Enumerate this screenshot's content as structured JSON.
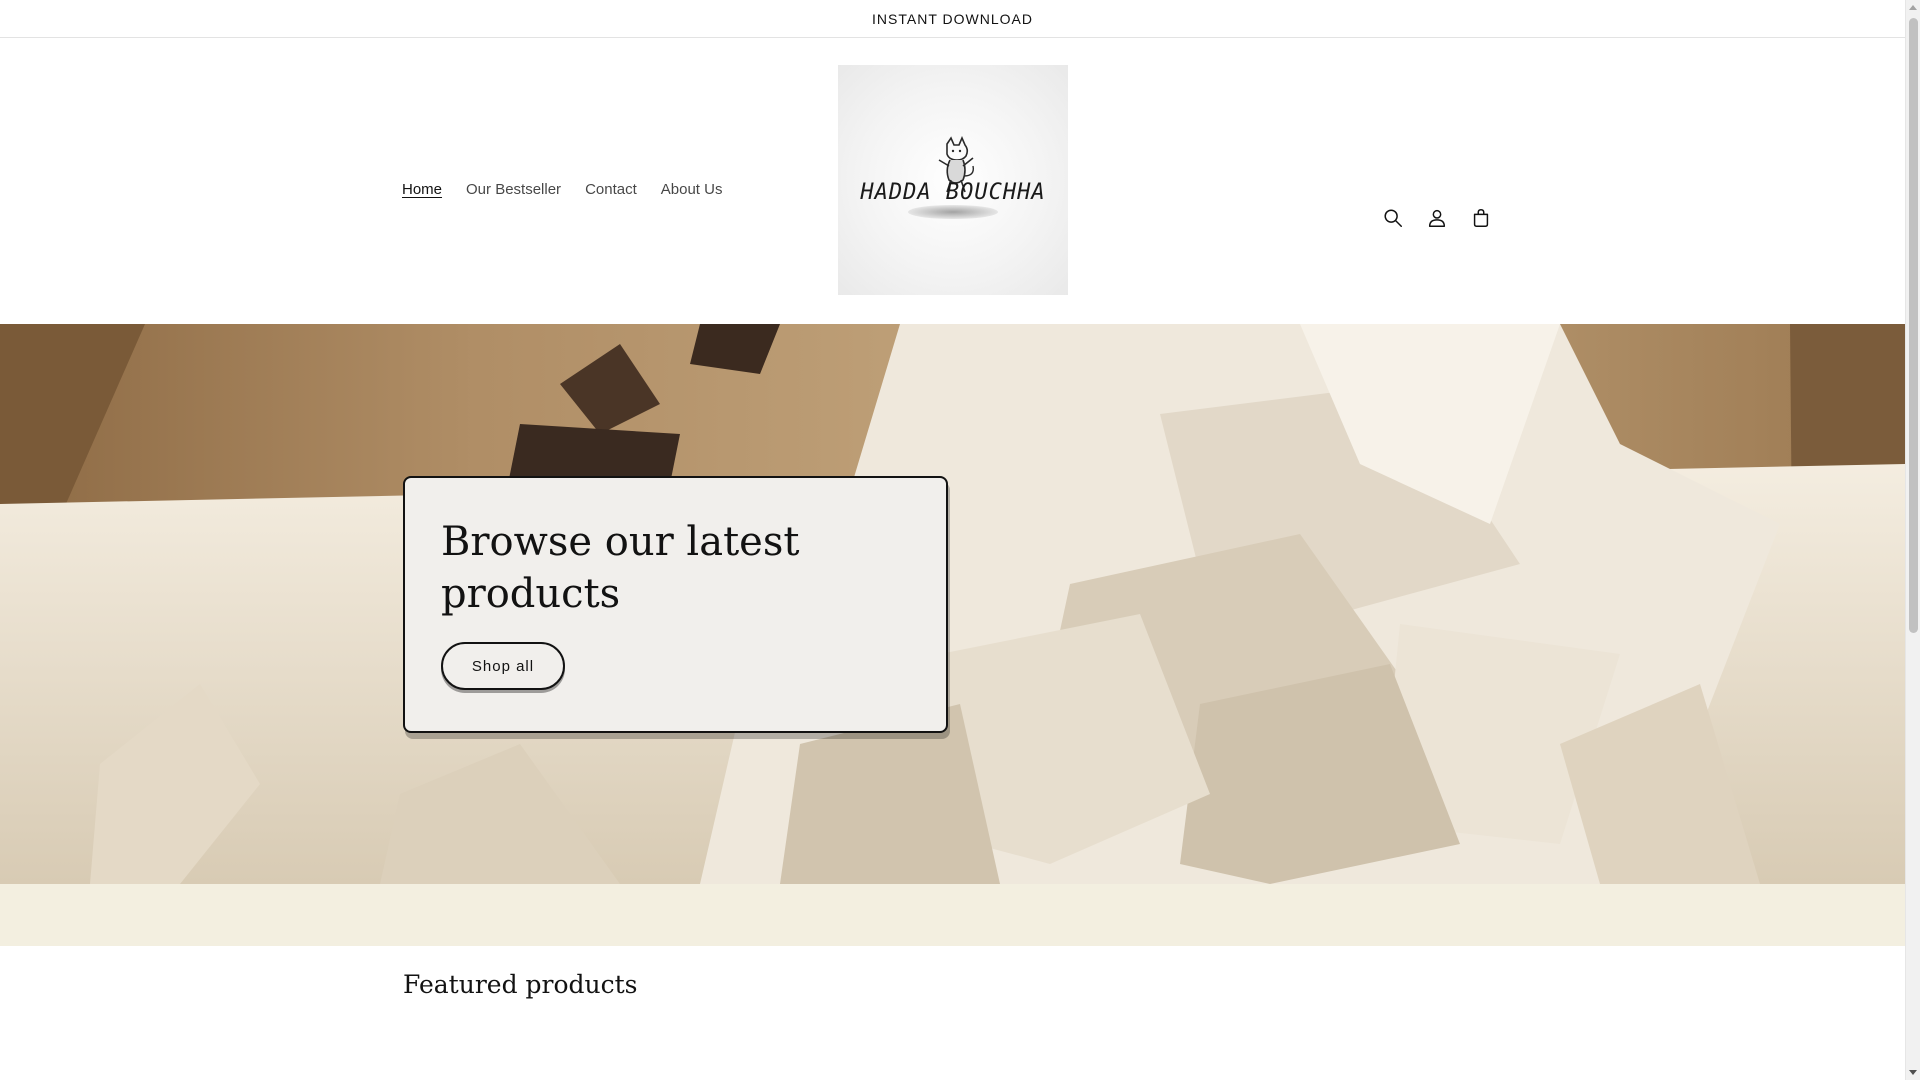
{
  "announcement": {
    "text": "INSTANT DOWNLOAD"
  },
  "nav": {
    "items": [
      {
        "label": "Home",
        "active": true
      },
      {
        "label": "Our Bestseller",
        "active": false
      },
      {
        "label": "Contact",
        "active": false
      },
      {
        "label": "About Us",
        "active": false
      }
    ]
  },
  "logo": {
    "text": "HADDA BOUCHHA"
  },
  "header_icons": [
    "search-icon",
    "account-icon",
    "cart-icon"
  ],
  "hero": {
    "title": "Browse our latest products",
    "button_label": "Shop all"
  },
  "featured": {
    "title": "Featured products"
  },
  "colors": {
    "text": "#121212",
    "band": "#f3efe0",
    "hero_box": "#f1efec"
  }
}
